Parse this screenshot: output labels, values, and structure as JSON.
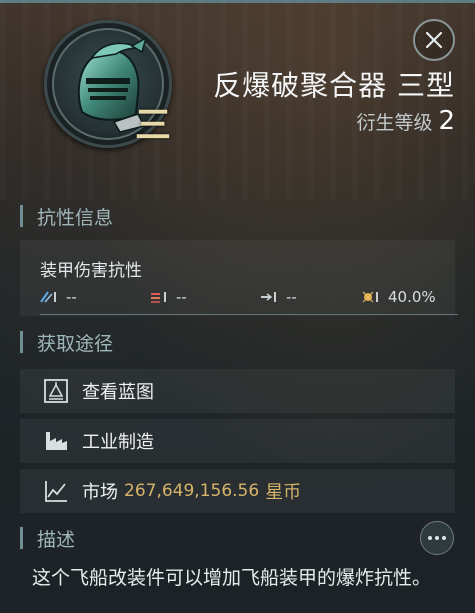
{
  "item": {
    "name": "反爆破聚合器 三型",
    "tier_mark": "三",
    "meta_level_label": "衍生等级",
    "meta_level_value": "2"
  },
  "icons": {
    "close": "close-icon",
    "more": "more-options-icon",
    "item": "helmet-icon"
  },
  "sections": {
    "resistance": "抗性信息",
    "acquisition": "获取途径",
    "description": "描述"
  },
  "resistance": {
    "title": "装甲伤害抗性",
    "items": [
      {
        "type": "em",
        "value": "--",
        "icon": "em-damage-icon"
      },
      {
        "type": "thermal",
        "value": "--",
        "icon": "thermal-damage-icon"
      },
      {
        "type": "kinetic",
        "value": "--",
        "icon": "kinetic-damage-icon"
      },
      {
        "type": "explosive",
        "value": "40.0%",
        "icon": "explosive-damage-icon"
      }
    ]
  },
  "acquisition": {
    "blueprint_label": "查看蓝图",
    "industry_label": "工业制造",
    "market_label": "市场",
    "market_price": "267,649,156.56",
    "market_currency": "星币"
  },
  "description": {
    "text": "这个飞船改装件可以增加飞船装甲的爆炸抗性。"
  },
  "colors": {
    "accent": "#6e8f94",
    "price": "#d6b46a",
    "section_label": "#9fb6ba",
    "tier": "#e8d9a8"
  }
}
